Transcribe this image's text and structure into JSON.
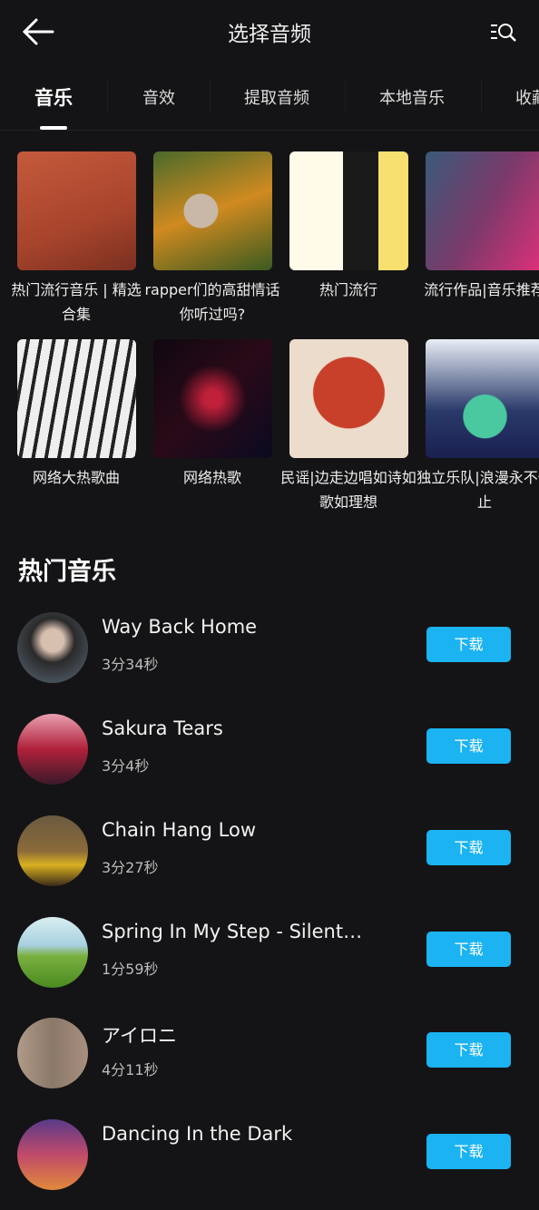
{
  "header": {
    "title": "选择音频"
  },
  "tabs": [
    {
      "label": "音乐"
    },
    {
      "label": "音效"
    },
    {
      "label": "提取音频"
    },
    {
      "label": "本地音乐"
    },
    {
      "label": "收藏"
    }
  ],
  "playlists": [
    {
      "title": "热门流行音乐 | 精选合集"
    },
    {
      "title": "rapper们的高甜情话你听过吗?"
    },
    {
      "title": "热门流行"
    },
    {
      "title": "流行作品|音乐推荐"
    },
    {
      "title": "网络大热歌曲"
    },
    {
      "title": "网络热歌"
    },
    {
      "title": "民谣|边走边唱如诗如歌如理想"
    },
    {
      "title": "独立乐队|浪漫永不停止"
    }
  ],
  "section_title": "热门音乐",
  "download_label": "下载",
  "songs": [
    {
      "title": "Way Back Home",
      "duration": "3分34秒"
    },
    {
      "title": "Sakura Tears",
      "duration": "3分4秒"
    },
    {
      "title": "Chain Hang Low",
      "duration": "3分27秒"
    },
    {
      "title": "Spring In My Step - Silent ...",
      "duration": "1分59秒"
    },
    {
      "title": "アイロニ",
      "duration": "4分11秒"
    },
    {
      "title": "Dancing In the Dark",
      "duration": ""
    }
  ],
  "colors": {
    "accent": "#1bb3f2",
    "background": "#141416"
  }
}
